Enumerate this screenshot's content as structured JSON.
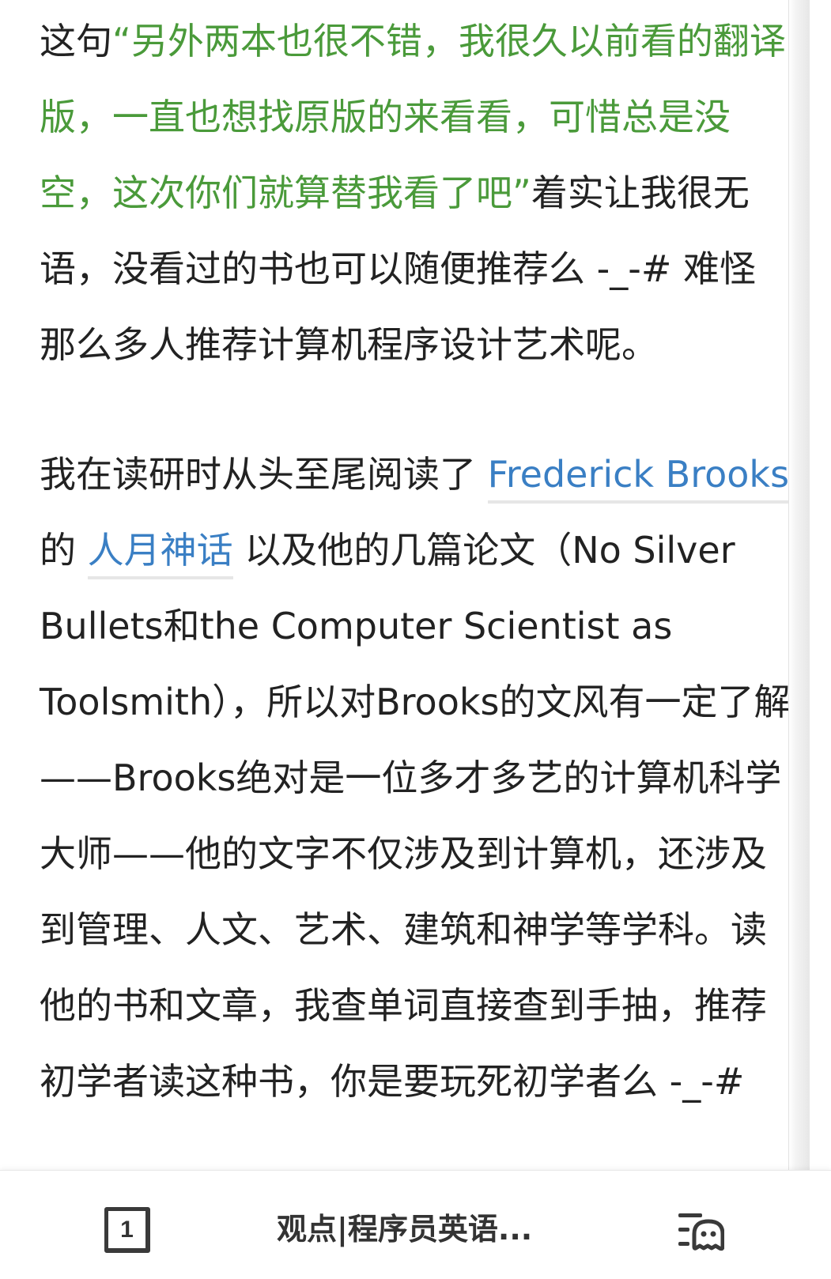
{
  "article": {
    "p1": {
      "before": "这句",
      "quote": "“另外两本也很不错，我很久以前看的翻译版，一直也想找原版的来看看，可惜总是没空，这次你们就算替我看了吧”",
      "after": "着实让我很无语，没看过的书也可以随便推荐么 -_-# 难怪那么多人推荐计算机程序设计艺术呢。"
    },
    "p2": {
      "t1": "我在读研时从头至尾阅读了 ",
      "link1": "Frederick Brooks",
      "t2": " 的 ",
      "link2": "人月神话",
      "t3": " 以及他的几篇论文（No Silver Bullets和the Computer Scientist as Toolsmith），所以对Brooks的文风有一定了解——Brooks绝对是一位多才多艺的计算机科学大师——他的文字不仅涉及到计算机，还涉及到管理、人文、艺术、建筑和神学等学科。读他的书和文章，我查单词直接查到手抽，推荐初学者读这种书，你是要玩死初学者么 -_-#"
    }
  },
  "bottom_bar": {
    "tab_count": "1",
    "title": "观点|程序员英语...",
    "reader_icon": "reader-mode-icon"
  },
  "colors": {
    "quote": "#4a9a3a",
    "link": "#3a7fc4",
    "text": "#222222"
  }
}
